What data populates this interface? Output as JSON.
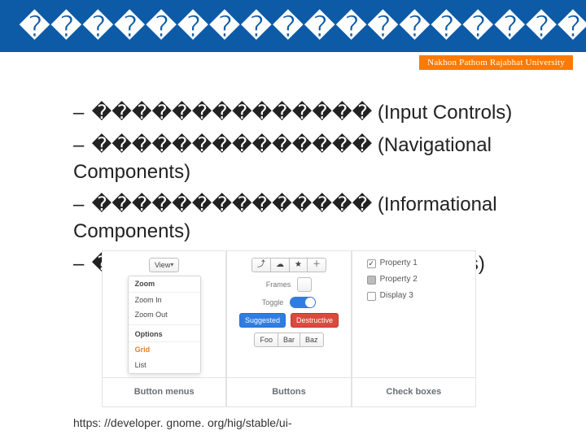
{
  "header": {
    "title_glyphs": "������������������"
  },
  "subheader": {
    "university": "Nakhon Pathom Rajabhat University"
  },
  "bullets": [
    {
      "prefix_glyphs": "��������������",
      "paren": "(Input Controls)"
    },
    {
      "prefix_glyphs": "��������������",
      "paren": "(Navigational Components)"
    },
    {
      "prefix_glyphs": "��������������",
      "paren": "(Informational Components)"
    },
    {
      "prefix_glyphs": "��������������",
      "paren": "(Containers)"
    }
  ],
  "figure": {
    "captions": [
      "Button menus",
      "Buttons",
      "Check boxes"
    ],
    "button_menus": {
      "trigger": "View",
      "menu": {
        "header": "Zoom",
        "items": [
          "Zoom In",
          "Zoom Out"
        ],
        "section_header": "Options",
        "option_selected": "Grid",
        "option_other": "List"
      }
    },
    "buttons": {
      "icons": [
        "share",
        "cloud",
        "star",
        "plus"
      ],
      "row2": "Frames",
      "row3": "Toggle",
      "suggested": "Suggested",
      "destructive": "Destructive",
      "seg": [
        "Foo",
        "Bar",
        "Baz"
      ]
    },
    "checkboxes": [
      {
        "label": "Property 1",
        "state": "on"
      },
      {
        "label": "Property 2",
        "state": "mixed"
      },
      {
        "label": "Display 3",
        "state": "off"
      }
    ]
  },
  "footer": {
    "url": "https: //developer. gnome. org/hig/stable/ui-"
  }
}
